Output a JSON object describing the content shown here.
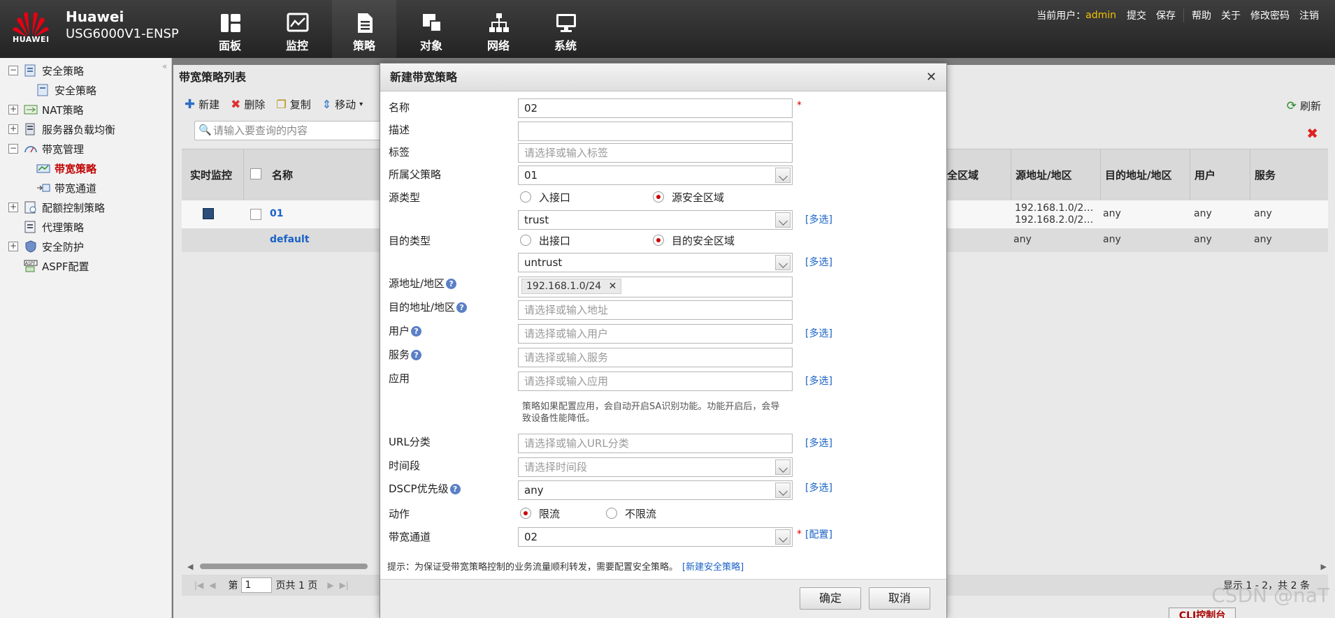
{
  "header": {
    "logo_text": "HUAWEI",
    "brand": "Huawei",
    "model": "USG6000V1-ENSP",
    "nav": [
      "面板",
      "监控",
      "策略",
      "对象",
      "网络",
      "系统"
    ],
    "current_user_label": "当前用户：",
    "current_user": "admin",
    "links": [
      "提交",
      "保存",
      "帮助",
      "关于",
      "修改密码",
      "注销"
    ]
  },
  "sidebar": {
    "items": [
      {
        "label": "安全策略",
        "toggle": "−"
      },
      {
        "label": "安全策略"
      },
      {
        "label": "NAT策略",
        "toggle": "+"
      },
      {
        "label": "服务器负载均衡",
        "toggle": "+"
      },
      {
        "label": "带宽管理",
        "toggle": "−"
      },
      {
        "label": "带宽策略"
      },
      {
        "label": "带宽通道"
      },
      {
        "label": "配额控制策略",
        "toggle": "+"
      },
      {
        "label": "代理策略"
      },
      {
        "label": "安全防护",
        "toggle": "+"
      },
      {
        "label": "ASPF配置"
      }
    ]
  },
  "main": {
    "title": "带宽策略列表",
    "toolbar": [
      "新建",
      "删除",
      "复制",
      "移动"
    ],
    "search_placeholder": "请输入要查询的内容",
    "refresh": "刷新",
    "columns": [
      "实时监控",
      "名称",
      "安全区域",
      "源地址/地区",
      "目的地址/地区",
      "用户",
      "服务"
    ],
    "rows": [
      {
        "name": "01",
        "src1": "192.168.1.0/2…",
        "src2": "192.168.2.0/2…",
        "dst": "any",
        "user": "any",
        "service": "any"
      },
      {
        "name": "default",
        "src": "any",
        "dst": "any",
        "user": "any",
        "service": "any"
      }
    ],
    "pager": {
      "prefix": "第",
      "page": "1",
      "suffix": "页共 1 页",
      "display": "显示 1 - 2，共 2 条"
    },
    "cli": "CLI控制台"
  },
  "dialog": {
    "title": "新建带宽策略",
    "fields": {
      "name_label": "名称",
      "name_value": "02",
      "desc_label": "描述",
      "desc_value": "",
      "tag_label": "标签",
      "tag_placeholder": "请选择或输入标签",
      "parent_label": "所属父策略",
      "parent_value": "01",
      "srctype_label": "源类型",
      "src_opt1": "入接口",
      "src_opt2": "源安全区域",
      "src_zone": "trust",
      "dsttype_label": "目的类型",
      "dst_opt1": "出接口",
      "dst_opt2": "目的安全区域",
      "dst_zone": "untrust",
      "srcaddr_label": "源地址/地区",
      "srcaddr_tag": "192.168.1.0/24",
      "dstaddr_label": "目的地址/地区",
      "dstaddr_placeholder": "请选择或输入地址",
      "user_label": "用户",
      "user_placeholder": "请选择或输入用户",
      "service_label": "服务",
      "service_placeholder": "请选择或输入服务",
      "app_label": "应用",
      "app_placeholder": "请选择或输入应用",
      "app_note": "策略如果配置应用，会自动开启SA识别功能。功能开启后，会导致设备性能降低。",
      "url_label": "URL分类",
      "url_placeholder": "请选择或输入URL分类",
      "time_label": "时间段",
      "time_placeholder": "请选择时间段",
      "dscp_label": "DSCP优先级",
      "dscp_value": "any",
      "action_label": "动作",
      "action_opt1": "限流",
      "action_opt2": "不限流",
      "channel_label": "带宽通道",
      "channel_value": "02"
    },
    "multi_select": "[多选]",
    "config_link": "[配置]",
    "footer_note": "提示：为保证受带宽策略控制的业务流量顺利转发，需要配置安全策略。",
    "footer_link": "[新建安全策略]",
    "ok": "确定",
    "cancel": "取消"
  },
  "watermark": "CSDN @naT"
}
